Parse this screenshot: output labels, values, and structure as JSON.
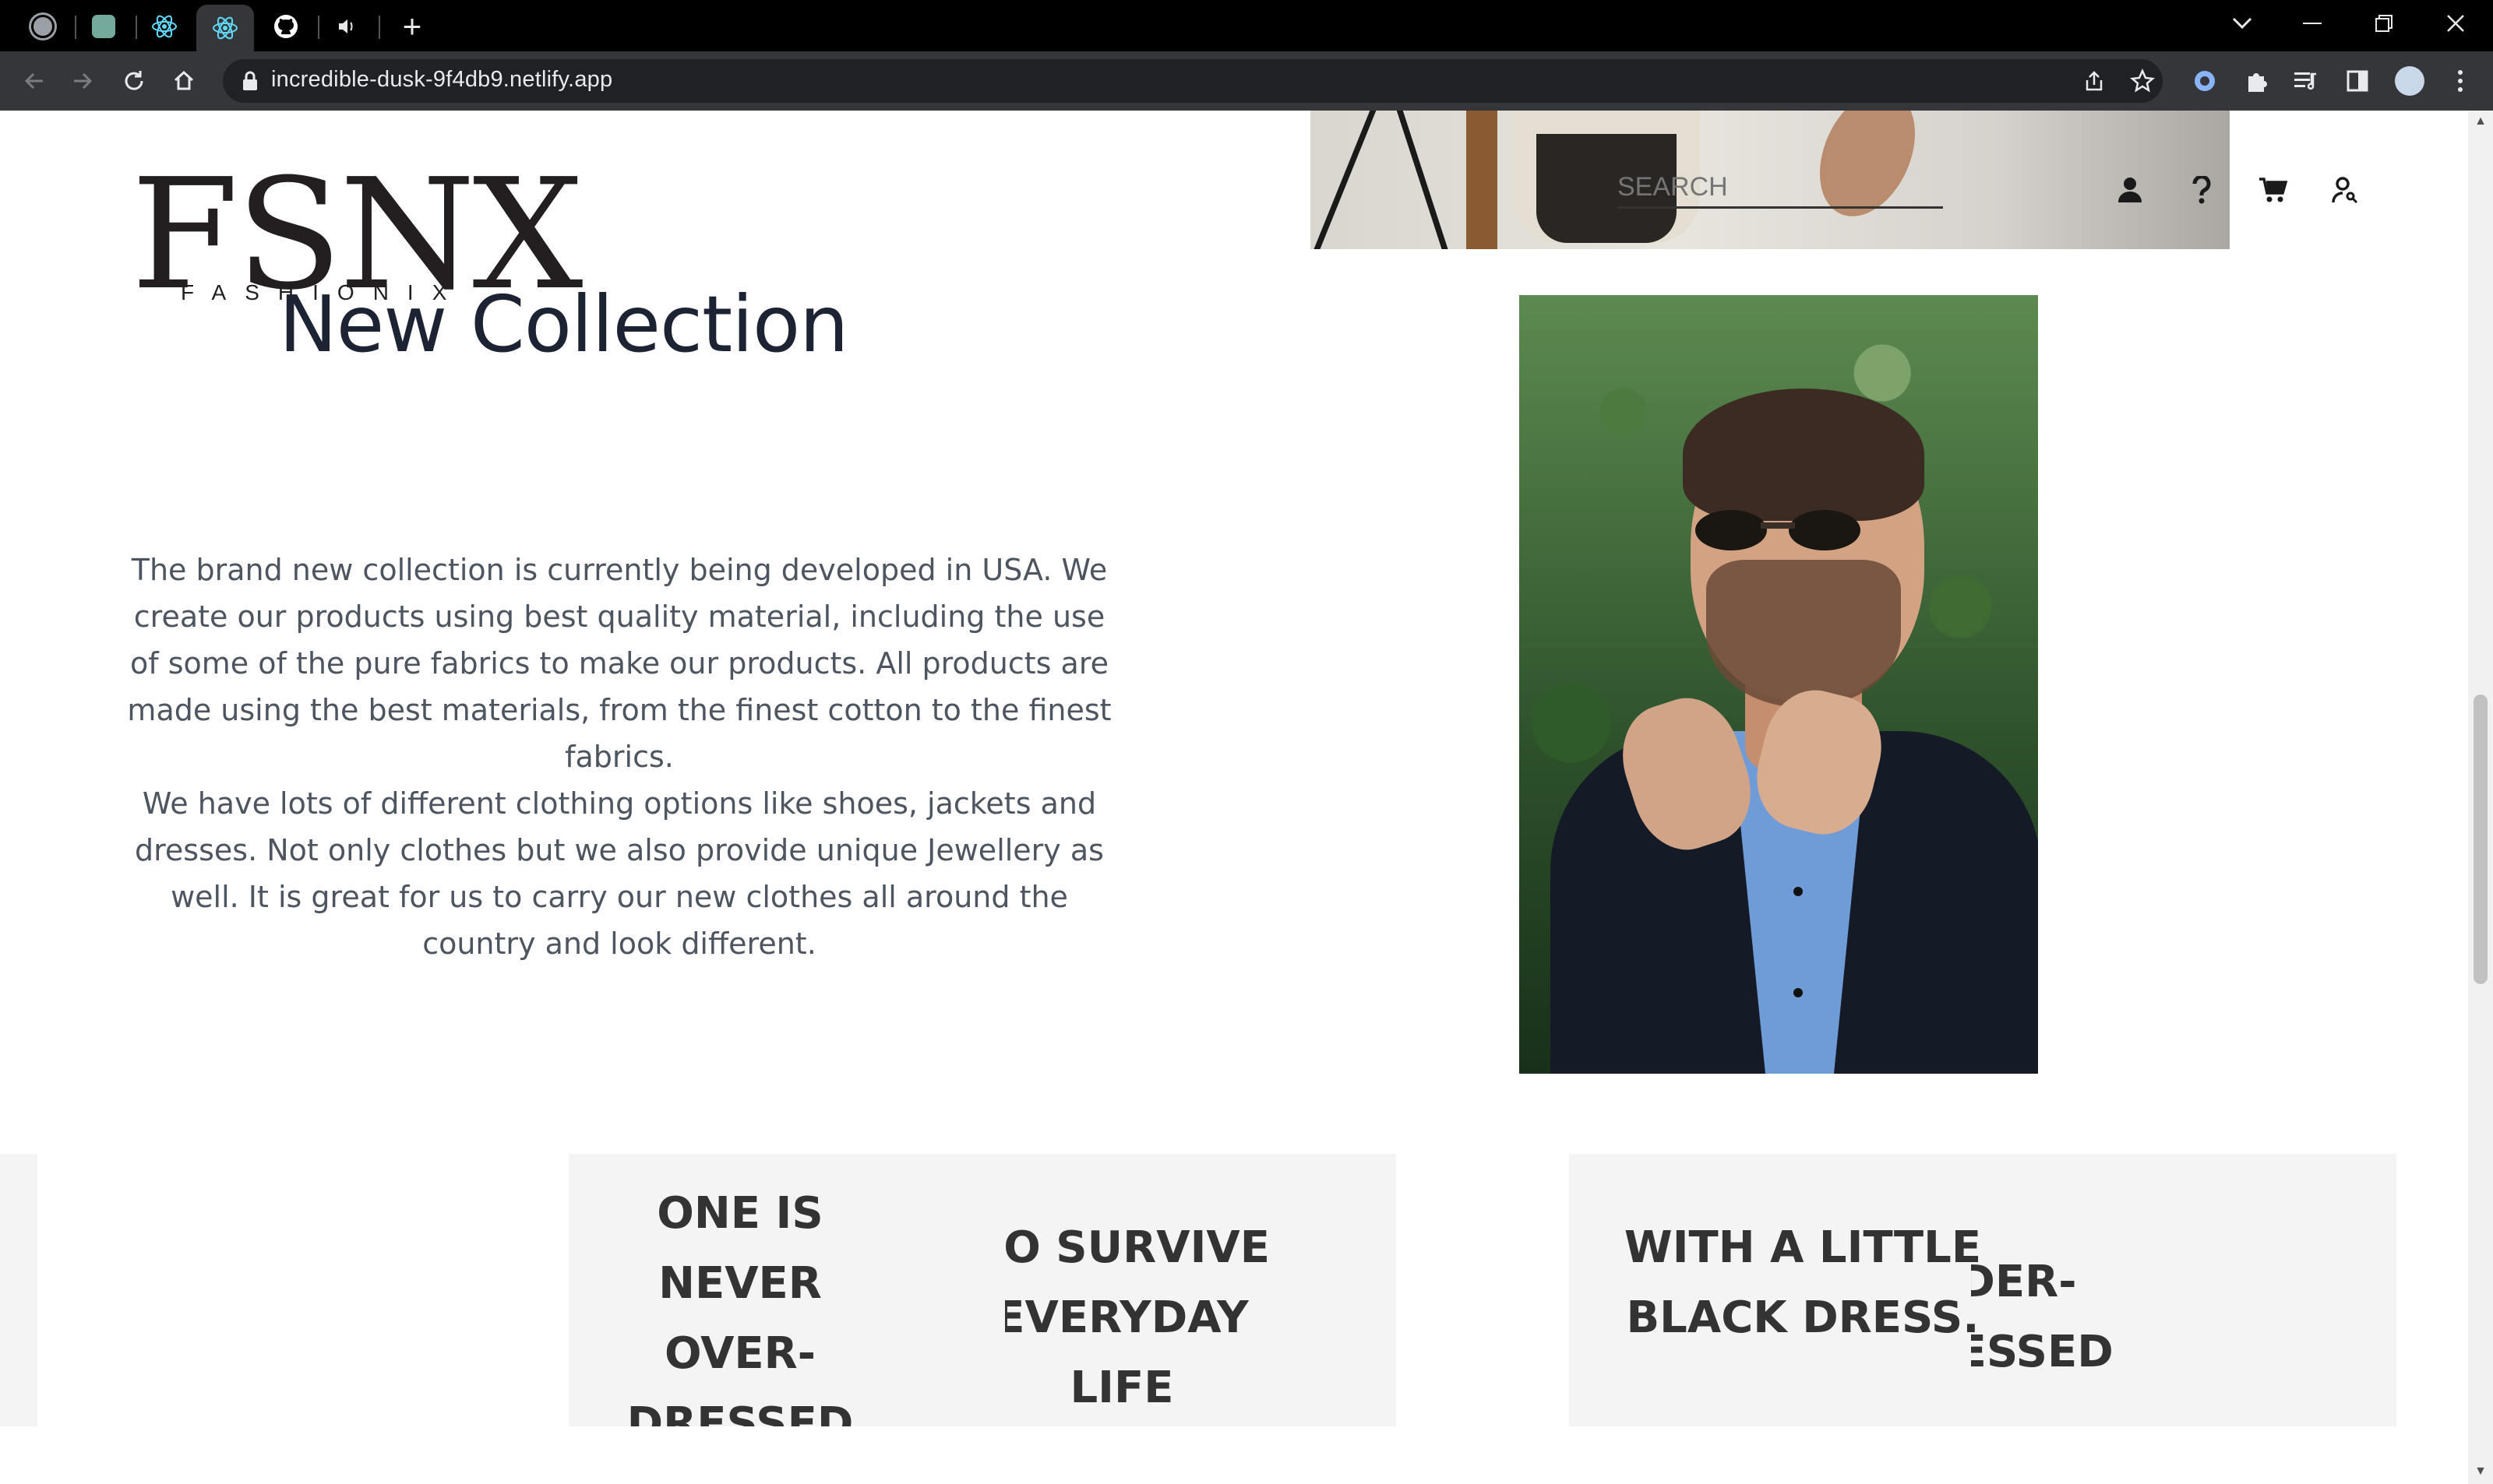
{
  "browser": {
    "url": "incredible-dusk-9f4db9.netlify.app",
    "tabs": [
      {
        "icon": "globe-icon"
      },
      {
        "icon": "chatgpt-icon"
      },
      {
        "icon": "react-icon"
      },
      {
        "icon": "react-icon",
        "active": true
      },
      {
        "icon": "github-icon"
      },
      {
        "icon": "speaker-icon"
      }
    ],
    "new_tab_symbol": "+"
  },
  "site": {
    "logo_mark": "FSNX",
    "logo_sub": "FASHIONIX",
    "search_placeholder": "SEARCH"
  },
  "section": {
    "heading": "New Collection",
    "paragraph_1": "The brand new collection is currently being developed in USA. We create our products using best quality material, including the use of some of the pure fabrics to make our products. All products are made using the best materials, from the finest cotton to the finest fabrics.",
    "paragraph_2": "We have lots of different clothing options like shoes, jackets and dresses. Not only clothes but we also provide unique Jewellery as well. It is great for us to carry our new clothes all around the country and look different."
  },
  "quotes": {
    "card1_text": "ONE IS NEVER\nOVER-DRESSED\nOR",
    "card1_partial": "TO SURVIVE\nEVERYDAY LIFE",
    "card2_text": "WITH A LITTLE\nBLACK DRESS.",
    "card2_partial": "UNDER-DRESSED"
  },
  "colors": {
    "heading": "#1c2333",
    "body_text": "#4d5560",
    "card_bg": "#f4f4f4",
    "quote_text": "#333333"
  }
}
